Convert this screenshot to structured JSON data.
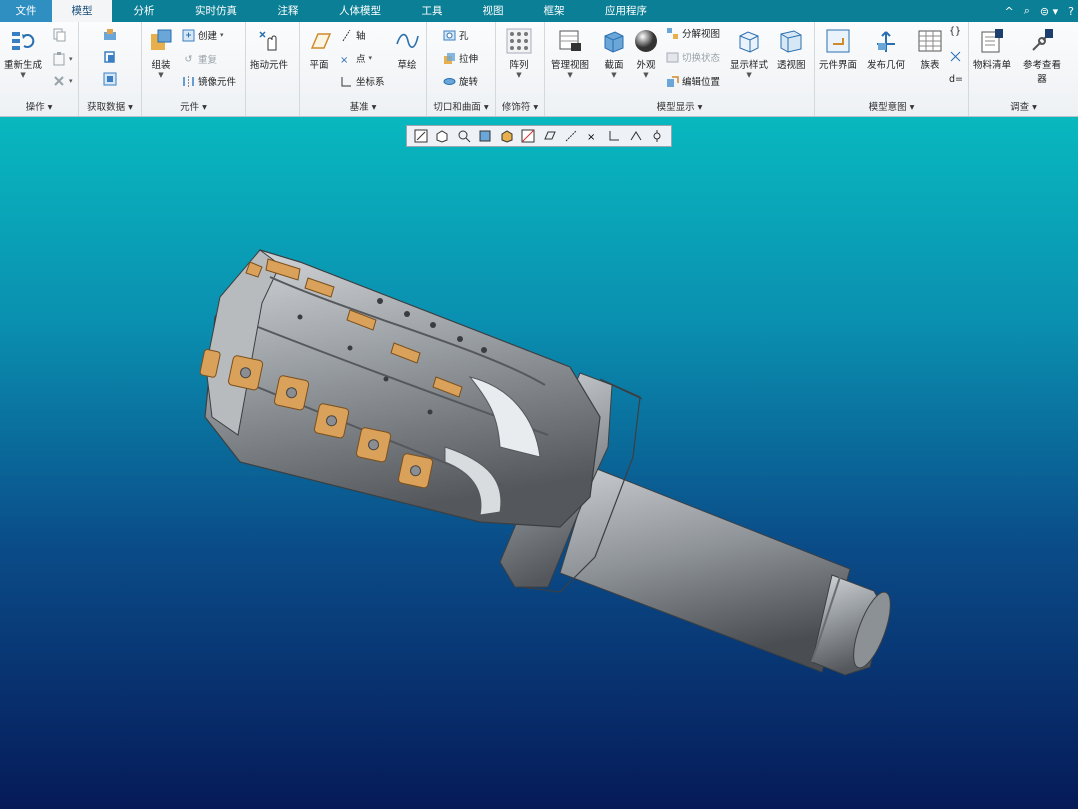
{
  "tabs": [
    "文件",
    "模型",
    "分析",
    "实时仿真",
    "注释",
    "人体模型",
    "工具",
    "视图",
    "框架",
    "应用程序"
  ],
  "window_controls": [
    "^",
    "⌕",
    "⊜ ▾",
    "?"
  ],
  "ribbon": {
    "ops": {
      "regenerate": "重新生成",
      "label": "操作"
    },
    "get_data": {
      "label": "获取数据"
    },
    "components": {
      "assemble": "组装",
      "create": "创建",
      "repeat": "重复",
      "mirror": "镜像元件",
      "label": "元件"
    },
    "drag": {
      "label": "拖动元件"
    },
    "datum": {
      "plane": "平面",
      "axis": "轴",
      "point": "点",
      "csys": "坐标系",
      "sketch": "草绘",
      "label": "基准"
    },
    "cut": {
      "hole": "孔",
      "extrude": "拉伸",
      "revolve": "旋转",
      "label": "切口和曲面"
    },
    "modifier": {
      "pattern": "阵列",
      "label": "修饰符"
    },
    "display": {
      "manage_views": "管理视图",
      "section": "截面",
      "appearance": "外观",
      "explode": "分解视图",
      "toggle_state": "切换状态",
      "edit_position": "编辑位置",
      "display_style": "显示样式",
      "perspective": "透视图",
      "label": "模型显示"
    },
    "intent": {
      "component_interface": "元件界面",
      "publish_geometry": "发布几何",
      "table": "族表",
      "label": "模型意图"
    },
    "investigate": {
      "bom": "物料清单",
      "ref_viewer_1": "参考查看",
      "ref_viewer_2": "器",
      "label": "调查"
    }
  },
  "colors": {
    "tabbar": "#0b7f95",
    "viewport_top": "#08b8bf",
    "viewport_bottom": "#061a58",
    "insert": "#d9a15a",
    "body": "#9a9fa3"
  }
}
